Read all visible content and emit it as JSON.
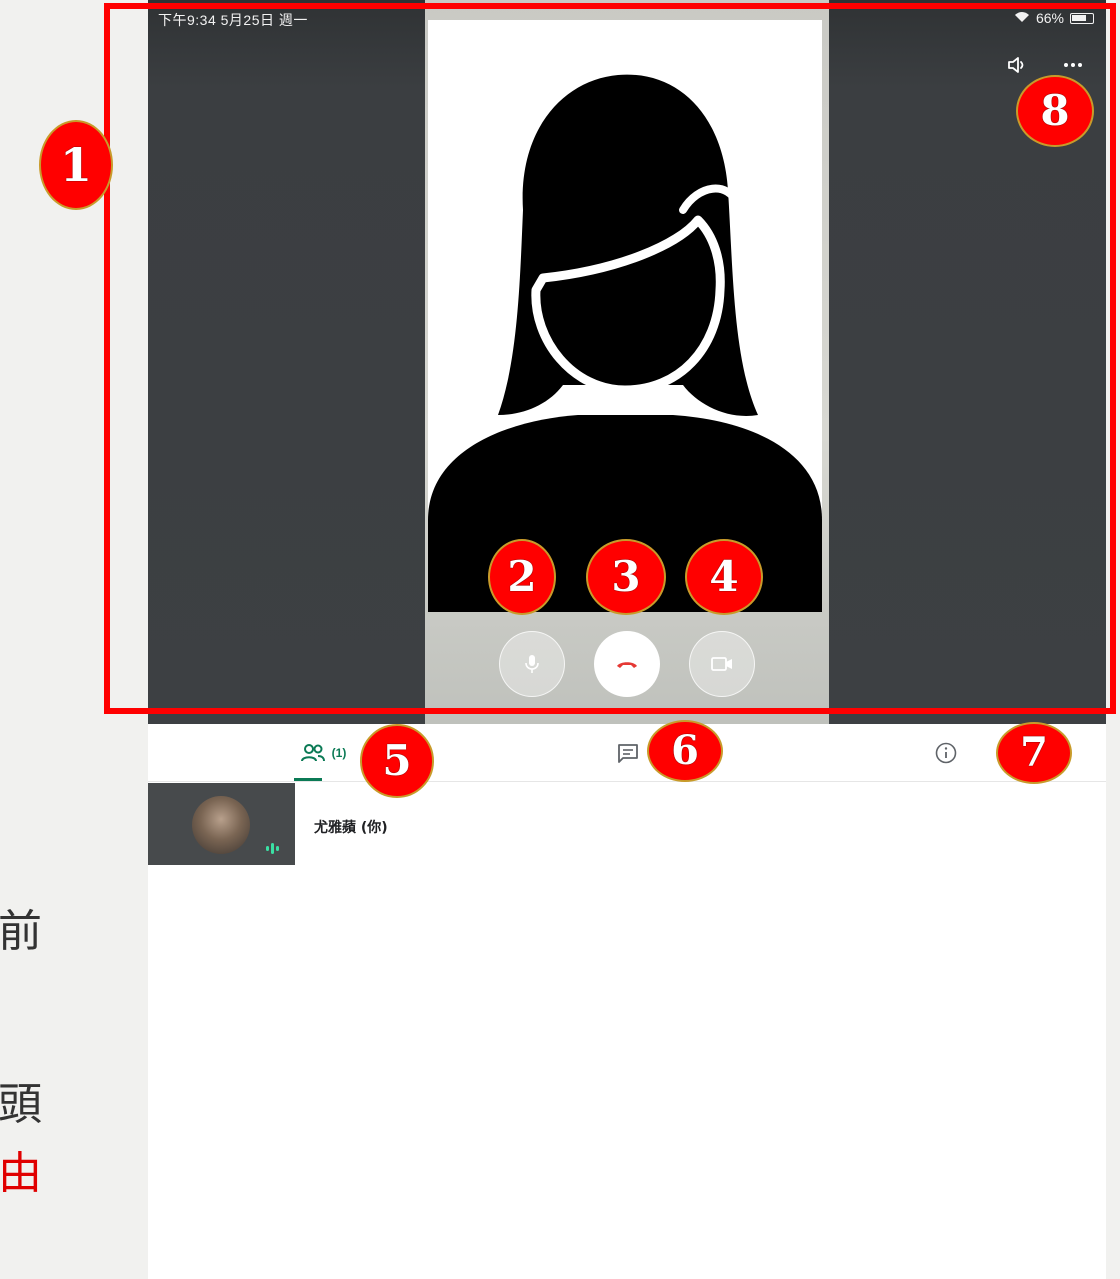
{
  "status_bar": {
    "time_date": "下午9:34  5月25日 週一",
    "battery": "66%"
  },
  "participants_tab": {
    "count": "(1)"
  },
  "participants": [
    {
      "name": "尤雅蘋 (你)"
    }
  ],
  "side_slide_text": [
    "前",
    "頭",
    "由"
  ],
  "annotations": [
    "1",
    "2",
    "3",
    "4",
    "5",
    "6",
    "7",
    "8"
  ],
  "colors": {
    "annotation_red": "#ff0000",
    "accent_green": "#0b7a55",
    "end_call_red": "#e53935"
  },
  "icons": {
    "mic": "mic-icon",
    "end_call": "phone-hangup-icon",
    "camera": "video-camera-icon",
    "speaker": "volume-icon",
    "more": "more-horiz-icon",
    "people": "people-icon",
    "chat": "chat-icon",
    "info": "info-icon"
  }
}
